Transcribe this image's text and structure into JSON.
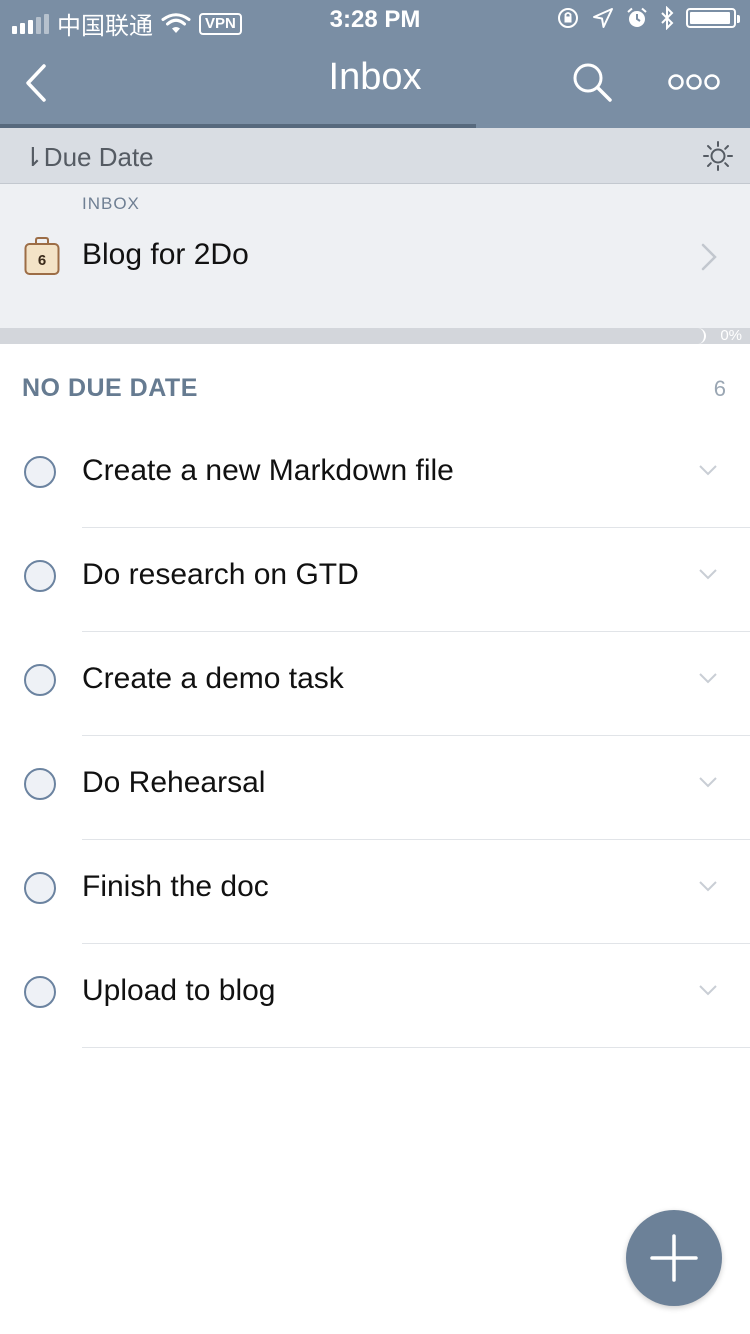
{
  "status_bar": {
    "carrier": "中国联通",
    "vpn_label": "VPN",
    "time": "3:28 PM"
  },
  "nav": {
    "title": "Inbox"
  },
  "sort_bar": {
    "label": "Due Date"
  },
  "list_card": {
    "section_label": "INBOX",
    "list_name": "Blog for 2Do",
    "badge_count": "6",
    "progress_label": "0%",
    "progress": 0
  },
  "section": {
    "title": "NO DUE DATE",
    "count": "6"
  },
  "tasks": [
    {
      "title": "Create a new Markdown file"
    },
    {
      "title": "Do research on GTD"
    },
    {
      "title": "Create a demo task"
    },
    {
      "title": "Do Rehearsal"
    },
    {
      "title": "Finish the doc"
    },
    {
      "title": "Upload to blog"
    }
  ],
  "colors": {
    "nav_background": "#7a8ea4",
    "accent": "#6c8198",
    "section_header": "#667b91"
  }
}
